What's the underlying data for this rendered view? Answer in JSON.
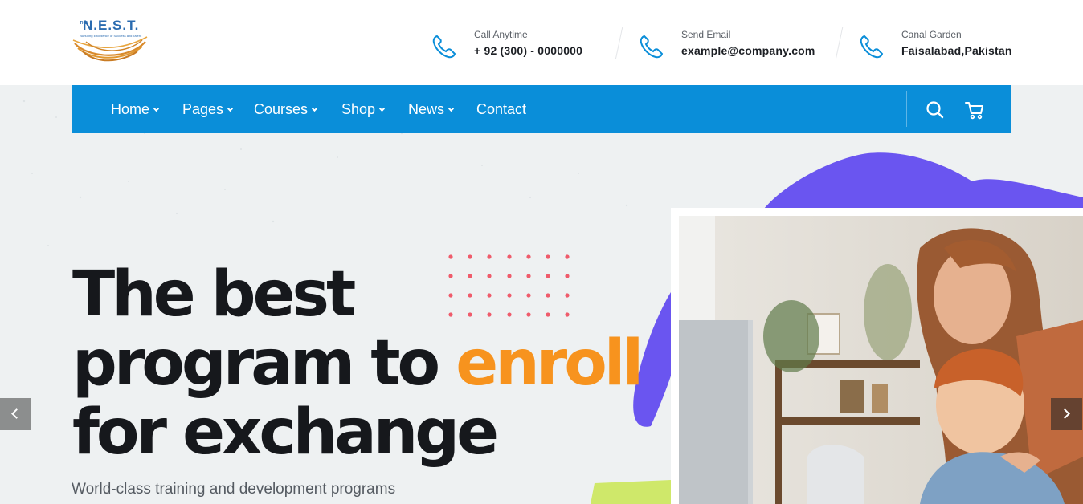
{
  "brand": {
    "logo_text": "N.E.S.T.",
    "logo_prefix": "THE",
    "logo_tagline": "Nurturing Excellence of Success and Talent",
    "colors": {
      "nav": "#0a8ed9",
      "accent": "#f7931e",
      "purple": "#6a55f0",
      "lime": "#cfe86a"
    }
  },
  "contacts": [
    {
      "label": "Call Anytime",
      "value": "+ 92 (300) - 0000000",
      "icon": "phone-icon"
    },
    {
      "label": "Send Email",
      "value": "example@company.com",
      "icon": "phone-icon"
    },
    {
      "label": "Canal Garden",
      "value": "Faisalabad,Pakistan",
      "icon": "phone-icon"
    }
  ],
  "nav": {
    "items": [
      {
        "label": "Home",
        "dropdown": true
      },
      {
        "label": "Pages",
        "dropdown": true
      },
      {
        "label": "Courses",
        "dropdown": true
      },
      {
        "label": "Shop",
        "dropdown": true
      },
      {
        "label": "News",
        "dropdown": true
      },
      {
        "label": "Contact",
        "dropdown": false
      }
    ],
    "icons": [
      "search-icon",
      "cart-icon"
    ]
  },
  "hero": {
    "line1": "The best",
    "line2a": "program to ",
    "line2b": "enroll",
    "line3": "for exchange",
    "subtitle": "World-class training and development programs"
  },
  "slider": {
    "prev_icon": "chevron-left-icon",
    "next_icon": "chevron-right-icon"
  }
}
